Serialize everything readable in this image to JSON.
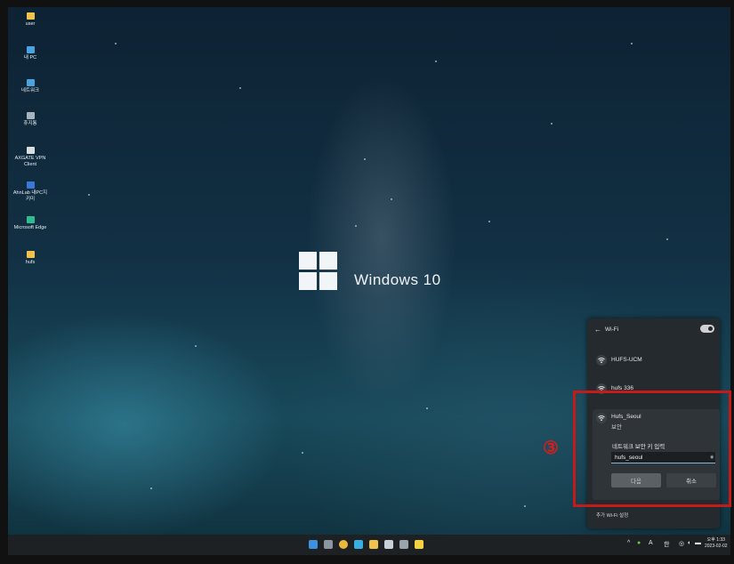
{
  "desktop": {
    "icons": [
      {
        "label": "user",
        "icon": "folder-icon",
        "color": "#f3c24a"
      },
      {
        "label": "내 PC",
        "icon": "computer-icon",
        "color": "#4aa3e0"
      },
      {
        "label": "네트워크",
        "icon": "network-icon",
        "color": "#4aa3e0"
      },
      {
        "label": "휴지통",
        "icon": "recycle-bin-icon",
        "color": "#a8b4bc"
      },
      {
        "label": "AXGATE VPN Client",
        "icon": "vpn-client-icon",
        "color": "#d8dde0"
      },
      {
        "label": "AhnLab 내PC지키미",
        "icon": "ahnlab-icon",
        "color": "#3b78d8"
      },
      {
        "label": "Microsoft Edge",
        "icon": "edge-icon",
        "color": "#2fbd8f"
      },
      {
        "label": "hufs",
        "icon": "folder-icon",
        "color": "#f3c24a"
      }
    ]
  },
  "wallpaper": {
    "title": "Windows 10"
  },
  "wifi_panel": {
    "back_icon": "←",
    "title": "Wi-Fi",
    "toggle_on": true,
    "networks": [
      {
        "name": "HUFS-UCM"
      },
      {
        "name": "hufs 336"
      }
    ],
    "active_network": {
      "name": "Hufs_Seoul",
      "security": "보안",
      "key_label": "네트워크 보안 키 입력",
      "key_value": "hufs_seoul",
      "next_label": "다음",
      "cancel_label": "취소"
    },
    "footer": "추가 Wi-Fi 설정"
  },
  "annotation": {
    "step": "③",
    "color": "#c51a1a"
  },
  "taskbar": {
    "apps": [
      {
        "name": "start-icon",
        "color": "#3d8fe0"
      },
      {
        "name": "task-view-icon",
        "color": "#8c96a0"
      },
      {
        "name": "chrome-icon",
        "color": "#e9b93a"
      },
      {
        "name": "edge-icon",
        "color": "#38b0e0"
      },
      {
        "name": "file-explorer-icon",
        "color": "#f0c24a"
      },
      {
        "name": "app-icon",
        "color": "#c8d0d8"
      },
      {
        "name": "terminal-icon",
        "color": "#9aa4ac"
      },
      {
        "name": "kakaotalk-icon",
        "color": "#f6d33c"
      }
    ],
    "tray": {
      "chevron": "^",
      "lang": "A",
      "ime": "한"
    },
    "clock": {
      "time": "오후 1:33",
      "date": "2023-02-02"
    }
  }
}
